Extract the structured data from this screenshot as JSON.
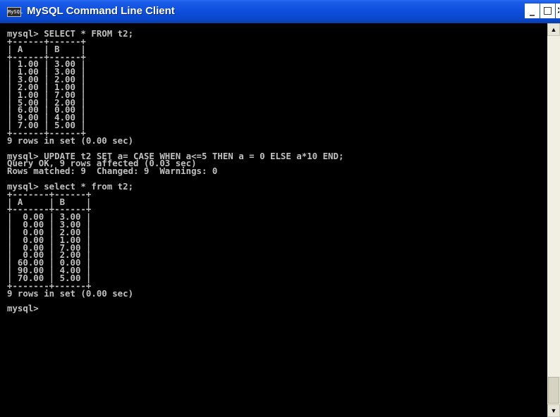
{
  "window": {
    "title": "MySQL Command Line Client",
    "icon_label": "MySQL",
    "controls": {
      "minimize": "_",
      "maximize": "□",
      "close": "×"
    }
  },
  "console": {
    "text": "mysql> SELECT * FROM t2;\n+------+------+\n| A    | B    |\n+------+------+\n| 1.00 | 3.00 |\n| 1.00 | 3.00 |\n| 3.00 | 2.00 |\n| 2.00 | 1.00 |\n| 1.00 | 7.00 |\n| 5.00 | 2.00 |\n| 6.00 | 0.00 |\n| 9.00 | 4.00 |\n| 7.00 | 5.00 |\n+------+------+\n9 rows in set (0.00 sec)\n\nmysql> UPDATE t2 SET a= CASE WHEN a<=5 THEN a = 0 ELSE a*10 END;\nQuery OK, 9 rows affected (0.03 sec)\nRows matched: 9  Changed: 9  Warnings: 0\n\nmysql> select * from t2;\n+-------+------+\n| A     | B    |\n+-------+------+\n|  0.00 | 3.00 |\n|  0.00 | 3.00 |\n|  0.00 | 2.00 |\n|  0.00 | 1.00 |\n|  0.00 | 7.00 |\n|  0.00 | 2.00 |\n| 60.00 | 0.00 |\n| 90.00 | 4.00 |\n| 70.00 | 5.00 |\n+-------+------+\n9 rows in set (0.00 sec)\n\nmysql>"
  },
  "scrollbar": {
    "up_arrow": "▲",
    "down_arrow": "▼"
  },
  "colors": {
    "titlebar": "#0d4fdc",
    "console_bg": "#000000",
    "console_text": "#c0c0c0",
    "scrollbar_bg": "#f1efe2"
  }
}
